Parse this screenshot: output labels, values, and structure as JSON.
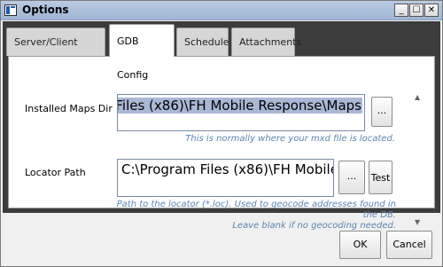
{
  "window": {
    "title": "Options",
    "minimize": "_",
    "maximize": "☐",
    "close": "✕"
  },
  "tabs": [
    {
      "label": "Server/Client Config",
      "active": false
    },
    {
      "label": "GDB Config",
      "active": true
    },
    {
      "label": "Schedule",
      "active": false
    },
    {
      "label": "Attachments",
      "active": false
    }
  ],
  "gdb": {
    "maps_label": "Installed Maps Dir",
    "maps_value_visible": "n Files (x86)\\FH Mobile Response\\Maps",
    "maps_browse": "...",
    "maps_hint": "This is normally where your mxd file is located.",
    "locator_label": "Locator Path",
    "locator_value_visible": "C:\\Program Files (x86)\\FH Mobile",
    "locator_browse": "...",
    "test": "Test",
    "locator_hint_1": "Path to the locator (*.loc). Used to geocode addresses found in the DB.",
    "locator_hint_2": "Leave blank if no geocoding needed."
  },
  "scroll": {
    "up": "▲",
    "down": "▼"
  },
  "footer": {
    "ok": "OK",
    "cancel": "Cancel"
  }
}
